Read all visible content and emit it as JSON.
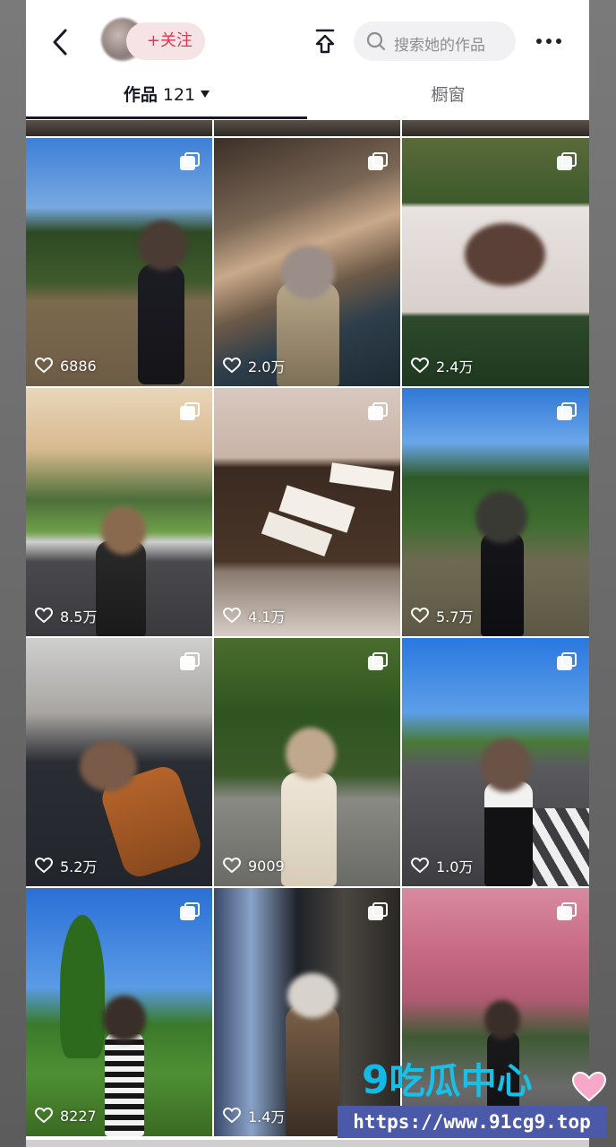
{
  "header": {
    "back_icon": "chevron-left-icon",
    "follow_label": "+关注",
    "share_icon": "share-upload-icon",
    "search_placeholder": "搜索她的作品",
    "more_icon": "more-dots-icon"
  },
  "tabs": {
    "works_label": "作品",
    "works_count": "121",
    "window_label": "橱窗"
  },
  "grid": {
    "items": [
      {
        "likes": "6886"
      },
      {
        "likes": "2.0万"
      },
      {
        "likes": "2.4万"
      },
      {
        "likes": "8.5万"
      },
      {
        "likes": "4.1万"
      },
      {
        "likes": "5.7万"
      },
      {
        "likes": "5.2万"
      },
      {
        "likes": "9009"
      },
      {
        "likes": "1.0万"
      },
      {
        "likes": "8227"
      },
      {
        "likes": "1.4万"
      },
      {
        "likes": ""
      }
    ]
  },
  "watermark": {
    "logo_text": "吃瓜中心",
    "logo_number": "9",
    "url": "https://www.91cg9.top"
  },
  "colors": {
    "accent": "#e3344e",
    "follow_bg": "#f6e3e6",
    "watermark_blue": "#18c0e8"
  }
}
